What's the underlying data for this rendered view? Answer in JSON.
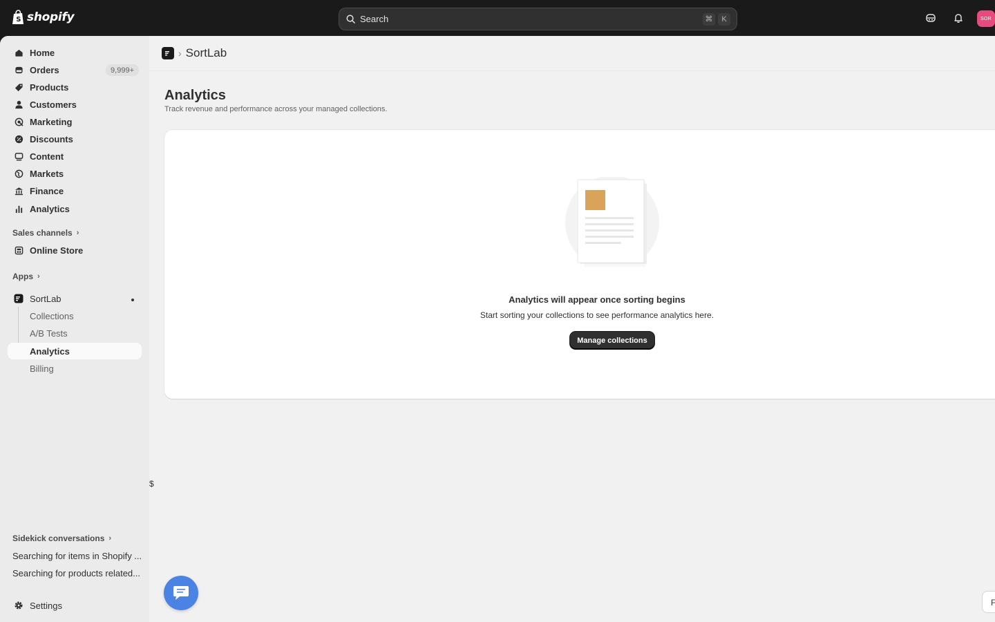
{
  "topbar": {
    "brand": "shopify",
    "search_placeholder": "Search",
    "shortcut_keys": [
      "⌘",
      "K"
    ],
    "avatar_initials": "SOR",
    "avatar_color": "#e54b7c"
  },
  "sidebar": {
    "items": [
      {
        "label": "Home",
        "icon": "home-icon"
      },
      {
        "label": "Orders",
        "icon": "orders-icon",
        "badge": "9,999+"
      },
      {
        "label": "Products",
        "icon": "tag-icon"
      },
      {
        "label": "Customers",
        "icon": "person-icon"
      },
      {
        "label": "Marketing",
        "icon": "target-icon"
      },
      {
        "label": "Discounts",
        "icon": "discount-icon"
      },
      {
        "label": "Content",
        "icon": "content-icon"
      },
      {
        "label": "Markets",
        "icon": "globe-icon"
      },
      {
        "label": "Finance",
        "icon": "bank-icon"
      },
      {
        "label": "Analytics",
        "icon": "bar-chart-icon"
      }
    ],
    "sales_channels": {
      "heading": "Sales channels",
      "items": [
        {
          "label": "Online Store",
          "icon": "store-icon"
        }
      ]
    },
    "apps": {
      "heading": "Apps",
      "app": {
        "label": "SortLab"
      },
      "sub_items": [
        "Collections",
        "A/B Tests",
        "Analytics",
        "Billing"
      ],
      "active_sub": "Analytics"
    },
    "sidekick": {
      "heading": "Sidekick conversations",
      "items": [
        "Searching for items in Shopify ...",
        "Searching for products related..."
      ]
    },
    "settings_label": "Settings"
  },
  "app_header": {
    "app_name": "SortLab"
  },
  "page": {
    "title": "Analytics",
    "subtitle": "Track revenue and performance across your managed collections."
  },
  "empty_state": {
    "heading": "Analytics will appear once sorting begins",
    "body": "Start sorting your collections to see performance analytics here.",
    "button_label": "Manage collections"
  },
  "stray_text": "$",
  "feedback_label": "F",
  "colors": {
    "topbar": "#1a1a1a",
    "sidebar": "#ebebeb",
    "content_bg": "#f1f1f1",
    "primary_button": "#303030",
    "chat_button": "#4a83e4",
    "illustration_square": "#d9a45a"
  }
}
